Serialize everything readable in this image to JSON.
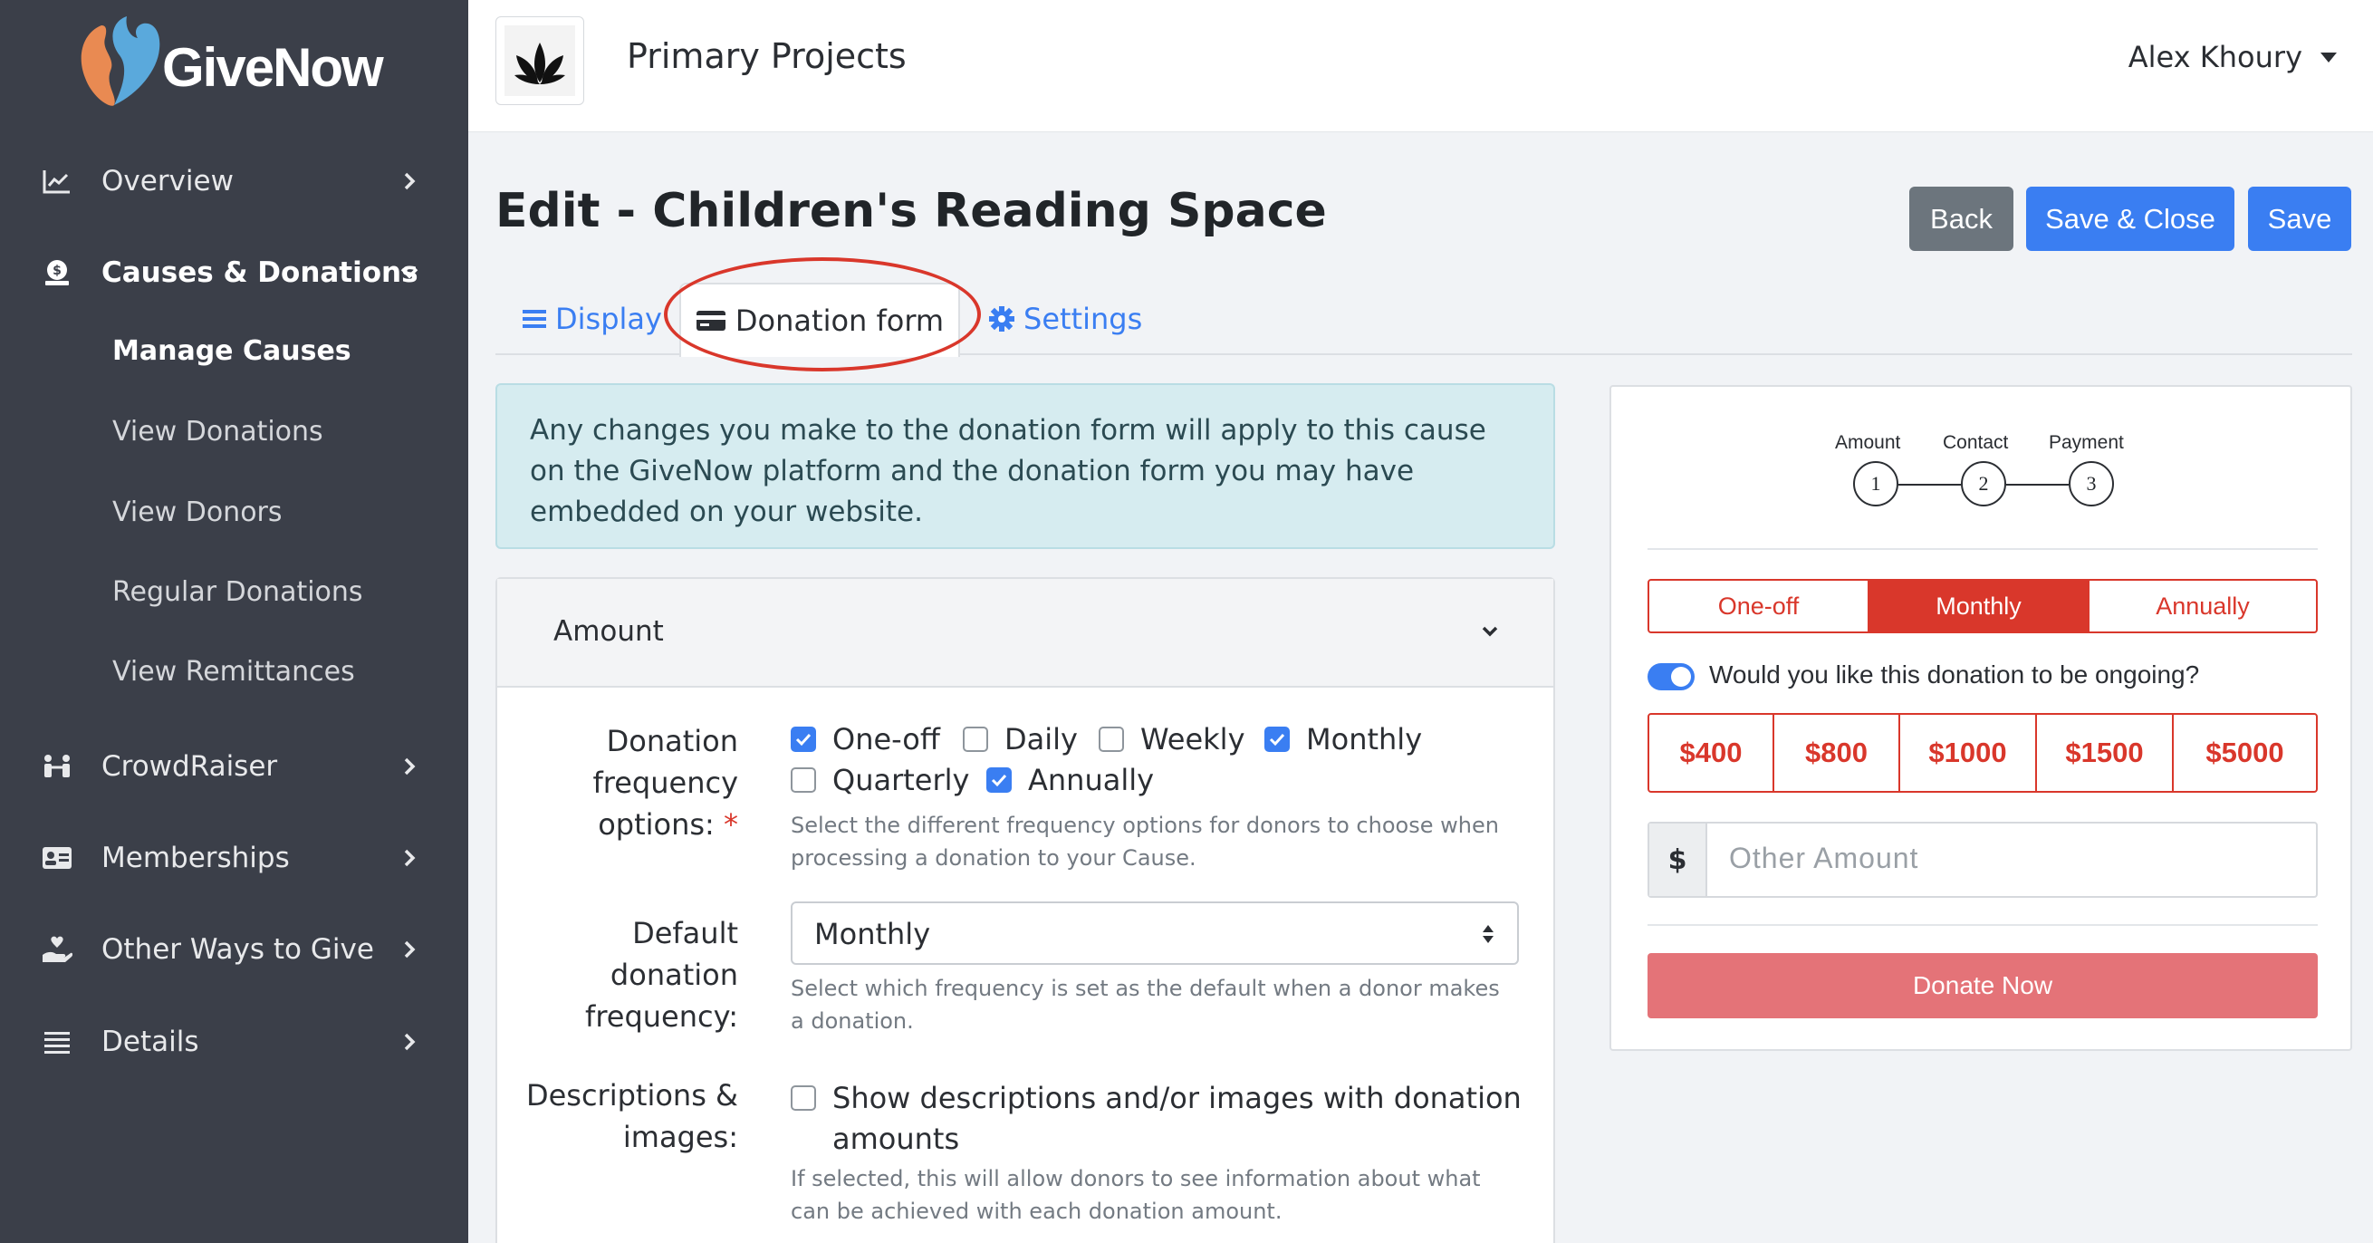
{
  "brand": {
    "name": "GiveNow"
  },
  "sidebar": {
    "items": [
      {
        "label": "Overview",
        "icon": "chart-line-icon"
      },
      {
        "label": "Causes & Donations",
        "icon": "money-bag-icon"
      },
      {
        "label": "CrowdRaiser",
        "icon": "people-icon"
      },
      {
        "label": "Memberships",
        "icon": "id-card-icon"
      },
      {
        "label": "Other Ways to Give",
        "icon": "hand-heart-icon"
      },
      {
        "label": "Details",
        "icon": "list-icon"
      }
    ],
    "subitems": [
      "Manage Causes",
      "View Donations",
      "View Donors",
      "Regular Donations",
      "View Remittances"
    ]
  },
  "header": {
    "project_name": "Primary Projects",
    "user_name": "Alex Khoury"
  },
  "page": {
    "title": "Edit - Children's Reading Space"
  },
  "actions": {
    "back": "Back",
    "save_close": "Save & Close",
    "save": "Save"
  },
  "tabs": {
    "display": "Display",
    "donation_form": "Donation form",
    "settings": "Settings"
  },
  "info": {
    "text": "Any changes you make to the donation form will apply to this cause on the GiveNow platform and the donation form you may have embedded on your website."
  },
  "amount_section": {
    "title": "Amount",
    "freq_label_1": "Donation",
    "freq_label_2": "frequency",
    "freq_label_3": "options:",
    "required_mark": "*",
    "options": [
      {
        "label": "One-off",
        "checked": true
      },
      {
        "label": "Daily",
        "checked": false
      },
      {
        "label": "Weekly",
        "checked": false
      },
      {
        "label": "Monthly",
        "checked": true
      },
      {
        "label": "Quarterly",
        "checked": false
      },
      {
        "label": "Annually",
        "checked": true
      }
    ],
    "freq_help": "Select the different frequency options for donors to choose when processing a donation to your Cause.",
    "default_label_1": "Default",
    "default_label_2": "donation",
    "default_label_3": "frequency:",
    "default_value": "Monthly",
    "default_help": "Select which frequency is set as the default when a donor makes a donation.",
    "desc_label_1": "Descriptions &",
    "desc_label_2": "images:",
    "desc_option_1": "Show descriptions and/or images with donation",
    "desc_option_2": "amounts",
    "desc_checked": false,
    "desc_help": "If selected, this will allow donors to see information about what can be achieved with each donation amount."
  },
  "preview": {
    "steps": [
      {
        "label": "Amount",
        "num": "1"
      },
      {
        "label": "Contact",
        "num": "2"
      },
      {
        "label": "Payment",
        "num": "3"
      }
    ],
    "frequencies": [
      "One-off",
      "Monthly",
      "Annually"
    ],
    "selected_frequency": "Monthly",
    "ongoing_label": "Would you like this donation to be ongoing?",
    "ongoing_enabled": true,
    "amounts": [
      "$400",
      "$800",
      "$1000",
      "$1500",
      "$5000"
    ],
    "currency": "$",
    "other_placeholder": "Other Amount",
    "donate_label": "Donate Now"
  },
  "colors": {
    "sidebar": "#3b3f49",
    "primary": "#3a7ef2",
    "accent": "#d9372b",
    "donate": "#e47378",
    "annotation": "#d9372b"
  }
}
